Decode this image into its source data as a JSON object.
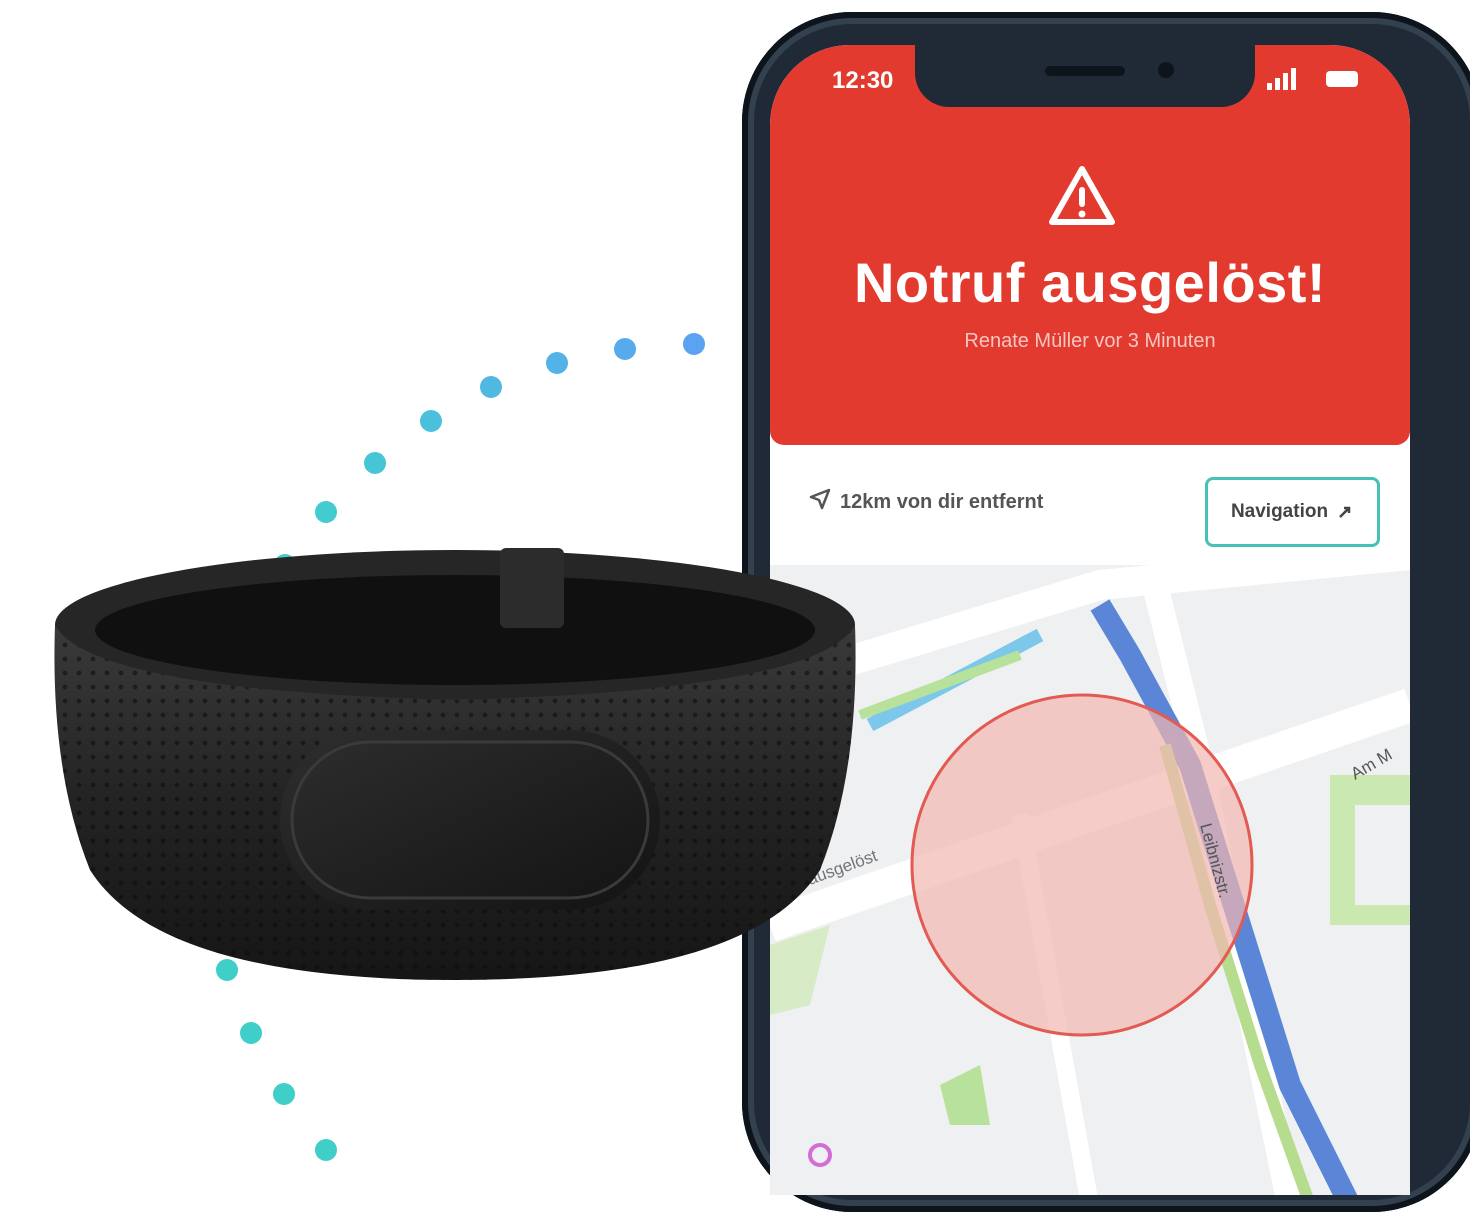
{
  "status_bar": {
    "time": "12:30"
  },
  "alert": {
    "title": "Notruf ausgelöst!",
    "subtitle": "Renate Müller vor 3 Minuten"
  },
  "info": {
    "distance": "12km von dir entfernt",
    "navigation_button": "Navigation"
  },
  "map": {
    "street_labels": [
      "Leibnizstr.",
      "ausgelöst",
      "Am M"
    ]
  },
  "icons": {
    "warning": "warning-triangle-icon",
    "location": "nav-arrow-icon",
    "external": "external-link-icon",
    "signal": "signal-icon",
    "battery": "battery-icon"
  },
  "colors": {
    "alert_red": "#e23a2f",
    "accent_teal": "#46c1b3",
    "dot_teal": "#3fcfc8",
    "dot_blue": "#5aa7ef"
  }
}
